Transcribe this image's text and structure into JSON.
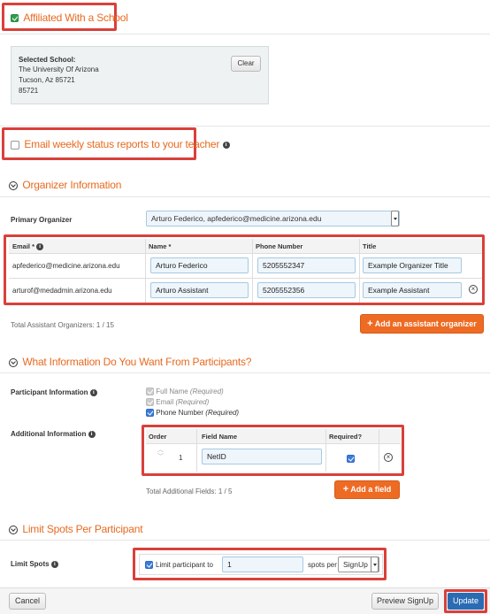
{
  "affiliation": {
    "label": "Affiliated With a School",
    "checked": true
  },
  "school": {
    "heading": "Selected School:",
    "name": "The University Of Arizona",
    "city_line": "Tucson, Az 85721",
    "zip": "85721",
    "clear_label": "Clear"
  },
  "email_reports": {
    "label": "Email weekly status reports to your teacher",
    "checked": false
  },
  "organizer": {
    "section_title": "Organizer Information",
    "primary_label": "Primary Organizer",
    "primary_value": "Arturo Federico, apfederico@medicine.arizona.edu",
    "columns": {
      "email": "Email *",
      "name": "Name *",
      "phone": "Phone Number",
      "title": "Title"
    },
    "rows": [
      {
        "email": "apfederico@medicine.arizona.edu",
        "name": "Arturo Federico",
        "phone": "5205552347",
        "title": "Example Organizer Title"
      },
      {
        "email": "arturof@medadmin.arizona.edu",
        "name": "Arturo Assistant",
        "phone": "5205552356",
        "title": "Example Assistant"
      }
    ],
    "total_label": "Total Assistant Organizers: 1 / 15",
    "add_label": "Add an assistant organizer"
  },
  "participants": {
    "section_title": "What Information Do You Want From Participants?",
    "info_label": "Participant Information",
    "options": [
      {
        "name": "Full Name",
        "note": "(Required)",
        "checked": true,
        "disabled": true
      },
      {
        "name": "Email",
        "note": "(Required)",
        "checked": true,
        "disabled": true
      },
      {
        "name": "Phone Number",
        "note": "(Required)",
        "checked": true,
        "disabled": false
      }
    ],
    "additional_label": "Additional Information",
    "fields_columns": {
      "order": "Order",
      "field_name": "Field Name",
      "required": "Required?"
    },
    "fields": [
      {
        "order": "1",
        "name": "NetID",
        "required": true
      }
    ],
    "total_label": "Total Additional Fields: 1 / 5",
    "add_label": "Add a field"
  },
  "limit": {
    "section_title": "Limit Spots Per Participant",
    "label": "Limit Spots",
    "checkbox_label": "Limit participant to",
    "value": "1",
    "spots_per": "spots per",
    "per_value": "SignUp"
  },
  "footer": {
    "cancel": "Cancel",
    "preview": "Preview SignUp",
    "update": "Update"
  },
  "colors": {
    "accent_orange": "#ee6b24",
    "highlight_red": "#d9403a",
    "update_blue": "#2a6bb3"
  }
}
